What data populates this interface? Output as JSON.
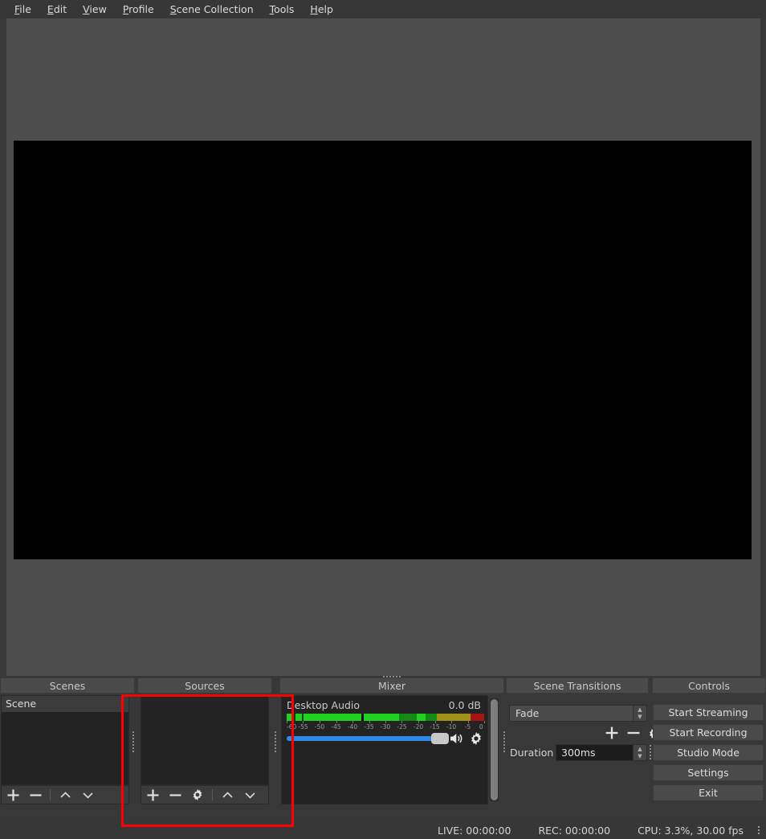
{
  "menu": {
    "items": [
      {
        "label": "File",
        "mnemonic": "F"
      },
      {
        "label": "Edit",
        "mnemonic": "E"
      },
      {
        "label": "View",
        "mnemonic": "V"
      },
      {
        "label": "Profile",
        "mnemonic": "P"
      },
      {
        "label": "Scene Collection",
        "mnemonic": "S"
      },
      {
        "label": "Tools",
        "mnemonic": "T"
      },
      {
        "label": "Help",
        "mnemonic": "H"
      }
    ]
  },
  "scenes": {
    "title": "Scenes",
    "items": [
      {
        "label": "Scene",
        "selected": true
      }
    ],
    "toolbar": {
      "add": "+",
      "remove": "−",
      "move_up": "move-up",
      "move_down": "move-down"
    }
  },
  "sources": {
    "title": "Sources",
    "items": [],
    "toolbar": {
      "add": "+",
      "remove": "−",
      "properties": "gear",
      "move_up": "move-up",
      "move_down": "move-down"
    }
  },
  "mixer": {
    "title": "Mixer",
    "channels": [
      {
        "name": "Desktop Audio",
        "db": "0.0 dB",
        "volume_percent": 93,
        "muted": false,
        "meter_ticks": [
          "-60",
          "-55",
          "-50",
          "-45",
          "-40",
          "-35",
          "-30",
          "-25",
          "-20",
          "-15",
          "-10",
          "-5",
          "0"
        ]
      }
    ]
  },
  "transitions": {
    "title": "Scene Transitions",
    "selected": "Fade",
    "duration_label": "Duration",
    "duration_value": "300ms",
    "buttons": {
      "add": "+",
      "remove": "−",
      "properties": "gear"
    }
  },
  "controls": {
    "title": "Controls",
    "buttons": [
      "Start Streaming",
      "Start Recording",
      "Studio Mode",
      "Settings",
      "Exit"
    ]
  },
  "status": {
    "live": "LIVE: 00:00:00",
    "rec": "REC: 00:00:00",
    "cpu": "CPU: 3.3%, 30.00 fps"
  },
  "colors": {
    "highlight": "#ff0000",
    "accent_blue": "#2e8ae6",
    "meter_green": "#1fd21f",
    "meter_yellow": "#9e9116",
    "meter_red": "#a81414",
    "window_bg": "#383838",
    "panel_bg": "#232323"
  }
}
